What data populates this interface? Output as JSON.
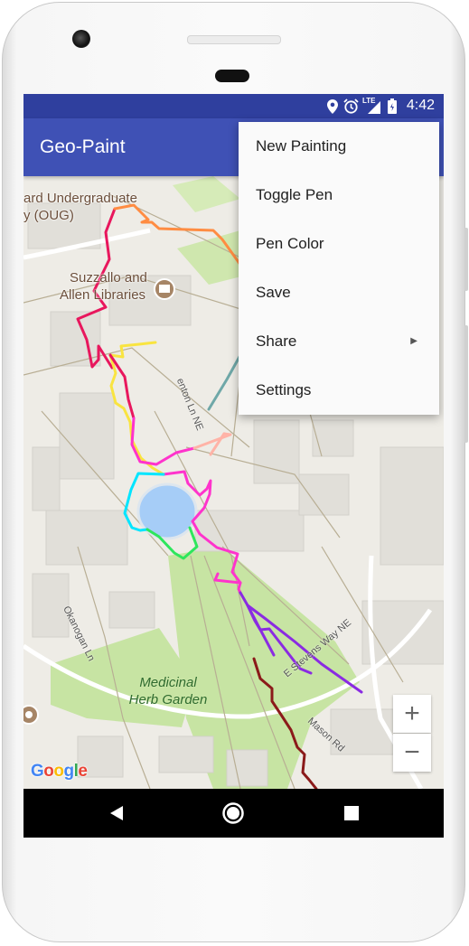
{
  "status_bar": {
    "time": "4:42",
    "network": "LTE",
    "icons": [
      "location-icon",
      "alarm-icon",
      "signal-icon",
      "battery-icon"
    ]
  },
  "app_bar": {
    "title": "Geo-Paint",
    "background": "#3f51b5",
    "status_background": "#2f3f9e"
  },
  "menu": {
    "items": [
      {
        "label": "New Painting"
      },
      {
        "label": "Toggle Pen"
      },
      {
        "label": "Pen Color"
      },
      {
        "label": "Save"
      },
      {
        "label": "Share",
        "submenu_icon": "triangle-right-icon"
      },
      {
        "label": "Settings"
      }
    ]
  },
  "map": {
    "labels": {
      "ugl_line1": "ard Undergraduate",
      "ugl_line2": "y (OUG)",
      "library_line1": "Suzzallo and",
      "library_line2": "Allen Libraries",
      "garden_line1": "Medicinal",
      "garden_line2": "Herb Garden"
    },
    "streets": {
      "benton": "enton Ln NE",
      "okanogan": "Okanogan Ln",
      "stevens": "E Stevens Way NE",
      "mason": "Mason Rd"
    },
    "zoom_in": "+",
    "zoom_out": "−",
    "attribution": "Google",
    "stroke_colors": [
      "#e8175d",
      "#ff8c42",
      "#f9e440",
      "#ff33cc",
      "#00e5ff",
      "#2ee65c",
      "#8b1a1a",
      "#8a2be2",
      "#ffb3a7",
      "#6fa8a8"
    ]
  },
  "nav_bar": {
    "back": "back-icon",
    "home": "home-icon",
    "recents": "recents-icon"
  }
}
